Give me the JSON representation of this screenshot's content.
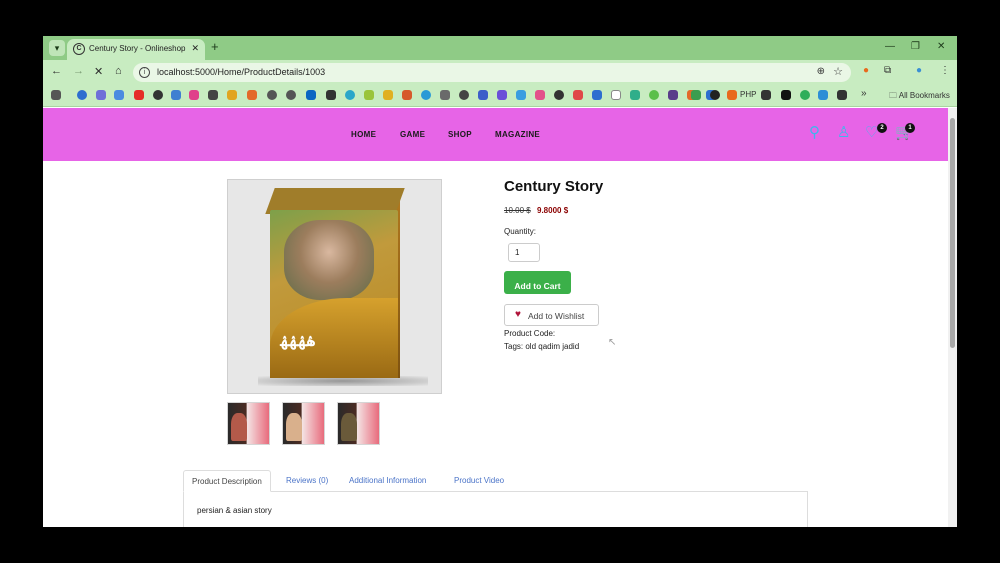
{
  "browser": {
    "tab_title": "Century Story - Onlineshop",
    "url": "localhost:5000/Home/ProductDetails/1003",
    "bookmark_php": "PHP",
    "all_bookmarks": "All Bookmarks"
  },
  "site": {
    "menu": [
      "HOME",
      "GAME",
      "SHOP",
      "MAGAZINE"
    ],
    "wishlist_count": "2",
    "cart_count": "1",
    "header_color": "#e764e7",
    "icon_color": "#3fb7ea"
  },
  "product": {
    "title": "Century Story",
    "old_price": "10.00 $",
    "new_price": "9.8000 $",
    "quantity_label": "Quantity:",
    "quantity": "1",
    "add_to_cart": "Add to Cart",
    "add_to_wishlist": "Add to Wishlist",
    "product_code": "Product Code:",
    "tags": "Tags: old qadim jadid"
  },
  "tabs": {
    "items": [
      "Product Description",
      "Reviews (0)",
      "Additional Information",
      "Product Video"
    ],
    "active": "Product Description",
    "description": "persian & asian story"
  }
}
